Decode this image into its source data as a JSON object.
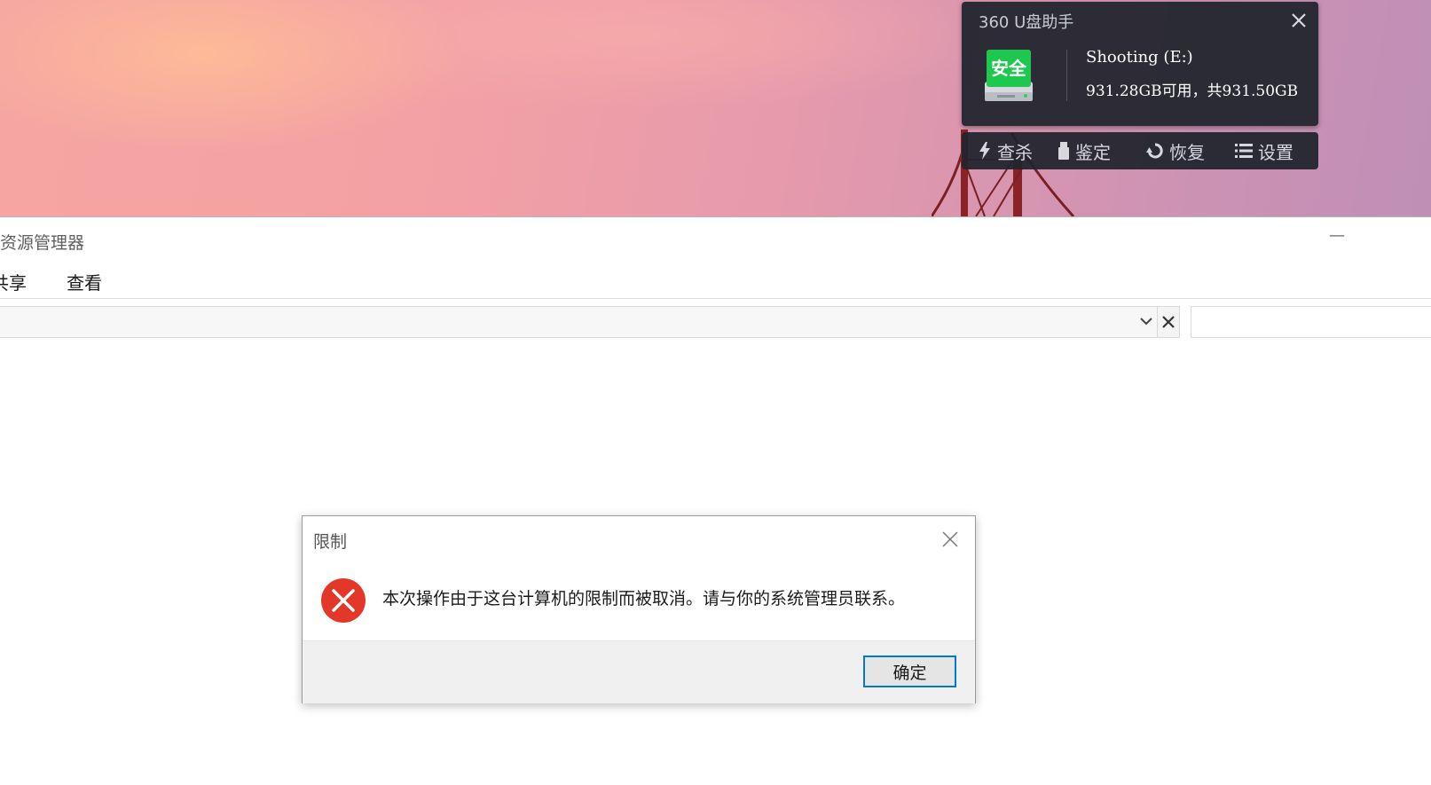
{
  "u_helper": {
    "title": "360 U盘助手",
    "badge": "安全",
    "drive_name": "Shooting (E:)",
    "drive_space": "931.28GB可用，共931.50GB",
    "tools": [
      {
        "label": "查杀",
        "icon": "lightning-icon"
      },
      {
        "label": "鉴定",
        "icon": "usb-drive-icon"
      },
      {
        "label": "恢复",
        "icon": "restore-icon"
      },
      {
        "label": "设置",
        "icon": "list-settings-icon"
      }
    ],
    "colors": {
      "panel": "#21242e",
      "badge_green": "#1ec84f"
    }
  },
  "explorer": {
    "title": "资源管理器",
    "ribbon_tabs": [
      "共享",
      "查看"
    ]
  },
  "dialog": {
    "title": "限制",
    "message": "本次操作由于这台计算机的限制而被取消。请与你的系统管理员联系。",
    "ok_label": "确定",
    "colors": {
      "error_red": "#e3372a",
      "focus_blue": "#0078d7"
    }
  }
}
